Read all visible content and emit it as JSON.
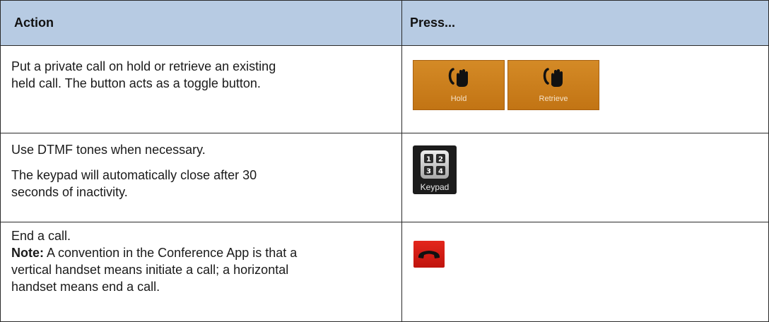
{
  "table": {
    "header": {
      "action": "Action",
      "press": "Press..."
    },
    "rows": [
      {
        "action_lines": [
          "Put a private call on hold or retrieve an existing",
          "held call. The button acts as a toggle button."
        ],
        "buttons": [
          {
            "label": "Hold",
            "icon": "hold-hand-icon"
          },
          {
            "label": "Retrieve",
            "icon": "retrieve-hand-icon"
          }
        ]
      },
      {
        "action_p1": "Use DTMF tones when necessary.",
        "action_p2_lines": [
          "The keypad will automatically close after 30",
          "seconds of inactivity."
        ],
        "button": {
          "label": "Keypad",
          "icon": "keypad-icon",
          "digits": [
            "1",
            "2",
            "3",
            "4"
          ]
        }
      },
      {
        "action_line1": "End a call.",
        "note_label": "Note:",
        "note_lines": [
          " A convention in the Conference App is that a",
          "vertical handset means initiate a call; a horizontal",
          "handset means end a call."
        ],
        "button": {
          "icon": "end-call-handset-icon"
        }
      }
    ]
  },
  "colors": {
    "header_bg": "#b7cbe3",
    "hold_button": "#c97b1a",
    "end_call_button": "#d41e15",
    "keypad_bg": "#1c1c1c"
  }
}
